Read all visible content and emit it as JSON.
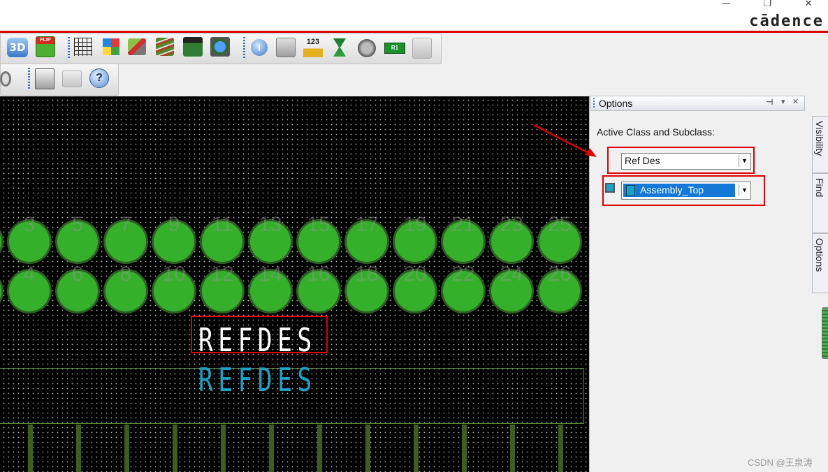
{
  "window": {
    "brand": "cādence",
    "controls": {
      "minimize": "—",
      "restore": "❐",
      "close": "✕"
    }
  },
  "toolbar": {
    "row1": [
      "3d-view-icon",
      "flip-icon",
      "grid-icon",
      "color-icon",
      "layers-icon",
      "stackup-icon",
      "ecm-icon",
      "world-view-icon",
      "info-icon",
      "properties-icon",
      "measure-icon",
      "hourglass-icon",
      "add-via-icon",
      "r1-icon",
      "snapshot-icon"
    ],
    "label_3d": "3D",
    "label_flip": "FLIP",
    "label_123": "123",
    "label_r1": "R1",
    "help": "?"
  },
  "canvas": {
    "top_row_numbers": [
      "3",
      "5",
      "7",
      "9",
      "11",
      "13",
      "15",
      "17",
      "19",
      "21",
      "23",
      "25"
    ],
    "bottom_row_numbers": [
      "4",
      "6",
      "8",
      "10",
      "12",
      "14",
      "16",
      "18",
      "20",
      "22",
      "24",
      "26"
    ],
    "refdes_white": "REFDES",
    "refdes_blue": "REFDES",
    "colors": {
      "pad": "#34b02a",
      "ref_white": "#ffffff",
      "ref_blue": "#1aa3c8",
      "outline": "#5a8a3a"
    }
  },
  "panel": {
    "title": "Options",
    "pin": "⊣",
    "menu": "▾",
    "close": "✕",
    "active_label": "Active Class and Subclass:",
    "class_value": "Ref Des",
    "subclass_value": "Assembly_Top",
    "subclass_color": "#1aa3c8",
    "tabs": [
      "Visibility",
      "Find",
      "Options"
    ]
  },
  "watermark": "CSDN @王泉涛"
}
